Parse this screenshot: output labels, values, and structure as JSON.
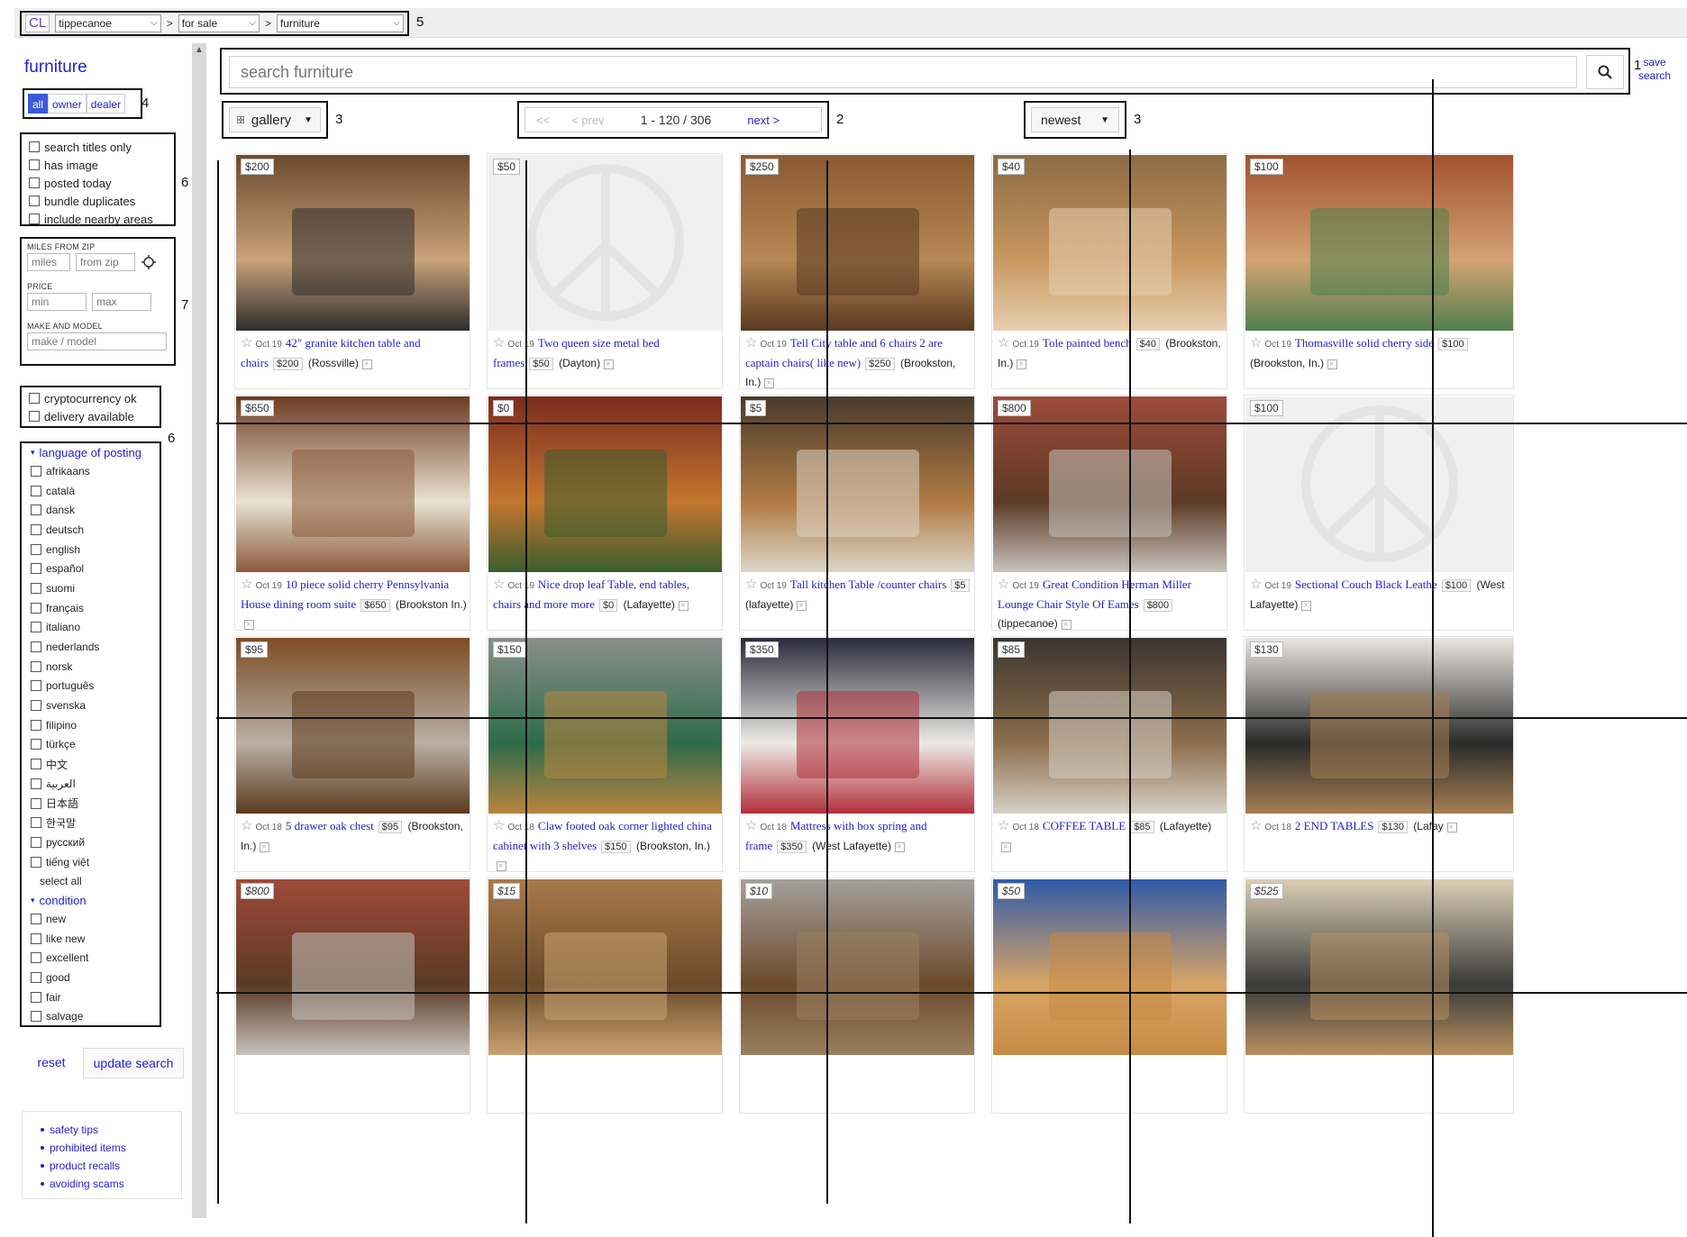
{
  "breadcrumb": {
    "logo": "CL",
    "area": "tippecanoe",
    "section": "for sale",
    "category": "furniture",
    "separator": ">",
    "annotation": "5"
  },
  "sidebar": {
    "title": "furniture",
    "toggles": [
      "all",
      "owner",
      "dealer"
    ],
    "toggle_active": "all",
    "annotation_toggles": "4",
    "filters": [
      "search titles only",
      "has image",
      "posted today",
      "bundle duplicates",
      "include nearby areas"
    ],
    "annotation_filters": "6",
    "miles_label": "MILES FROM ZIP",
    "miles_placeholder": "miles",
    "zip_placeholder": "from zip",
    "price_label": "PRICE",
    "min_placeholder": "min",
    "max_placeholder": "max",
    "make_label": "MAKE AND MODEL",
    "make_placeholder": "make / model",
    "annotation_fields": "7",
    "extra_filters": [
      "cryptocurrency ok",
      "delivery available"
    ],
    "annotation_extra": "6",
    "language_heading": "language of posting",
    "languages": [
      "afrikaans",
      "català",
      "dansk",
      "deutsch",
      "english",
      "español",
      "suomi",
      "français",
      "italiano",
      "nederlands",
      "norsk",
      "português",
      "svenska",
      "filipino",
      "türkçe",
      "中文",
      "العربية",
      "日本語",
      "한국말",
      "русский",
      "tiếng việt"
    ],
    "select_all": "select all",
    "condition_heading": "condition",
    "conditions": [
      "new",
      "like new",
      "excellent",
      "good",
      "fair",
      "salvage"
    ],
    "reset_label": "reset",
    "update_label": "update search",
    "help_links": [
      "safety tips",
      "prohibited items",
      "product recalls",
      "avoiding scams"
    ]
  },
  "search": {
    "placeholder": "search furniture",
    "annotation": "1",
    "save_line1": "save",
    "save_line2": "search"
  },
  "controls": {
    "view_label": "gallery",
    "view_annotation": "3",
    "pager_first": "<<",
    "pager_prev": "< prev",
    "pager_range": "1 - 120 / 306",
    "pager_next": "next >",
    "pager_annotation": "2",
    "sort_label": "newest",
    "sort_annotation": "3"
  },
  "listings": [
    {
      "price": "$200",
      "date": "Oct 19",
      "title": "42\" granite kitchen table and chairs",
      "hood": "(Rossville)"
    },
    {
      "price": "$50",
      "date": "Oct 19",
      "title": "Two queen size metal bed frames",
      "hood": "(Dayton)",
      "no_image": true
    },
    {
      "price": "$250",
      "date": "Oct 19",
      "title": "Tell City table and 6 chairs 2 are captain chairs( like new)",
      "hood": "(Brookston, In.)"
    },
    {
      "price": "$40",
      "date": "Oct 19",
      "title": "Tole painted bench",
      "hood": "(Brookston, In.)"
    },
    {
      "price": "$100",
      "date": "Oct 19",
      "title": "Thomasville solid cherry side",
      "hood": "(Brookston, In.)"
    },
    {
      "price": "$650",
      "date": "Oct 19",
      "title": "10 piece solid cherry Pennsylvania House dining room suite",
      "hood": "(Brookston In.)"
    },
    {
      "price": "$0",
      "date": "Oct 19",
      "title": "Nice drop leaf Table, end tables, chairs and more more",
      "hood": "(Lafayette)"
    },
    {
      "price": "$5",
      "date": "Oct 19",
      "title": "Tall kitchen Table /counter chairs",
      "hood": "(lafayette)"
    },
    {
      "price": "$800",
      "date": "Oct 19",
      "title": "Great Condition Herman Miller Lounge Chair Style Of Eames",
      "hood": "(tippecanoe)"
    },
    {
      "price": "$100",
      "date": "Oct 19",
      "title": "Sectional Couch Black Leathe",
      "hood": "(West Lafayette)",
      "no_image": true
    },
    {
      "price": "$95",
      "date": "Oct 18",
      "title": "5 drawer oak chest",
      "hood": "(Brookston, In.)"
    },
    {
      "price": "$150",
      "date": "Oct 18",
      "title": "Claw footed oak corner lighted china cabinet with 3 shelves",
      "hood": "(Brookston, In.)"
    },
    {
      "price": "$350",
      "date": "Oct 18",
      "title": "Mattress with box spring and frame",
      "hood": "(West Lafayette)"
    },
    {
      "price": "$85",
      "date": "Oct 18",
      "title": "COFFEE TABLE",
      "hood": "(Lafayette)"
    },
    {
      "price": "$130",
      "date": "Oct 18",
      "title": "2 END TABLES",
      "hood": "(Lafay"
    },
    {
      "price": "$800",
      "date": "",
      "title": "",
      "hood": ""
    },
    {
      "price": "$15",
      "date": "",
      "title": "",
      "hood": ""
    },
    {
      "price": "$10",
      "date": "",
      "title": "",
      "hood": ""
    },
    {
      "price": "$50",
      "date": "",
      "title": "",
      "hood": ""
    },
    {
      "price": "$525",
      "date": "",
      "title": "",
      "hood": ""
    }
  ],
  "colors": {
    "link": "#2222cc",
    "accent": "#3a5bd9",
    "annotation_border": "#111111"
  }
}
